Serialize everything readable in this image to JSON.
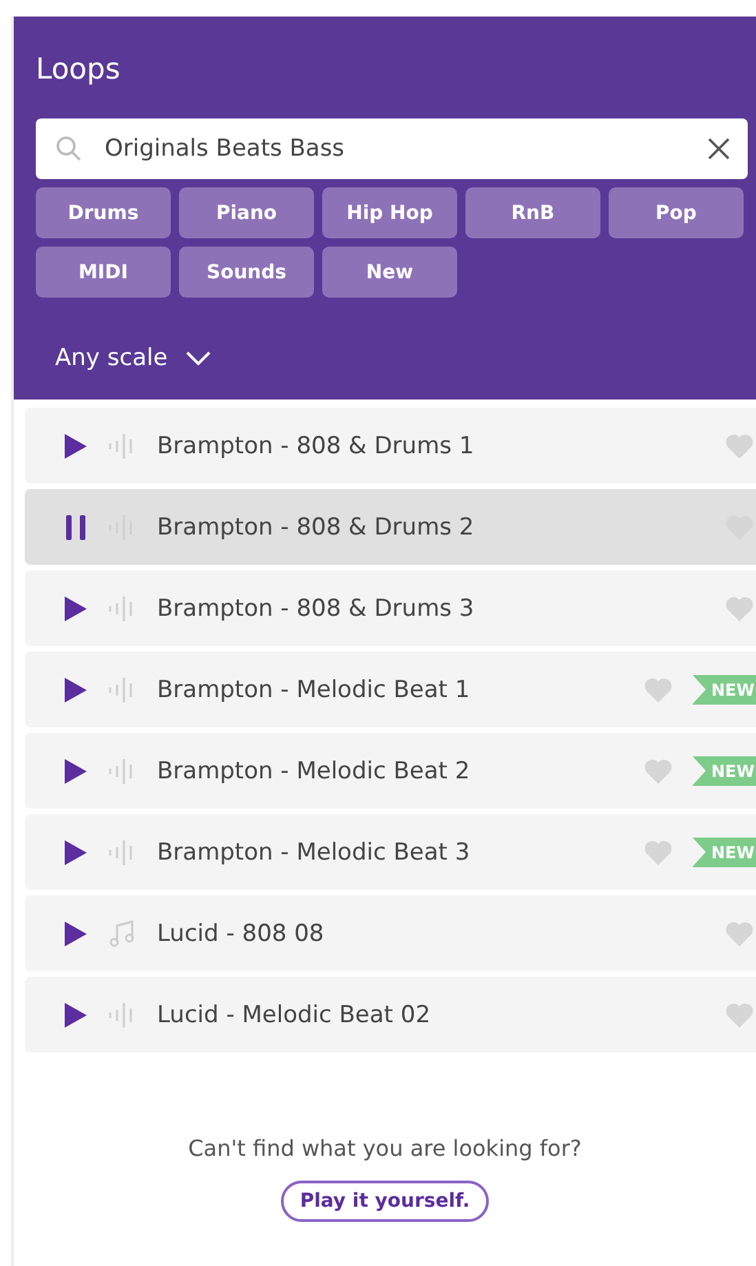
{
  "title": "Loops",
  "search": {
    "value": "Originals Beats Bass"
  },
  "filters": [
    {
      "label": "Drums"
    },
    {
      "label": "Piano"
    },
    {
      "label": "Hip Hop"
    },
    {
      "label": "RnB"
    },
    {
      "label": "Pop"
    },
    {
      "label": "MIDI"
    },
    {
      "label": "Sounds"
    },
    {
      "label": "New"
    }
  ],
  "scale": {
    "label": "Any scale"
  },
  "loops": [
    {
      "name": "Brampton - 808 & Drums 1",
      "playing": false,
      "kind": "audio",
      "new": false
    },
    {
      "name": "Brampton - 808 & Drums 2",
      "playing": true,
      "kind": "audio",
      "new": false
    },
    {
      "name": "Brampton - 808 & Drums 3",
      "playing": false,
      "kind": "audio",
      "new": false
    },
    {
      "name": "Brampton - Melodic Beat 1",
      "playing": false,
      "kind": "audio",
      "new": true,
      "badge": "NEW"
    },
    {
      "name": "Brampton - Melodic Beat 2",
      "playing": false,
      "kind": "audio",
      "new": true,
      "badge": "NEW"
    },
    {
      "name": "Brampton - Melodic Beat 3",
      "playing": false,
      "kind": "audio",
      "new": true,
      "badge": "NEW"
    },
    {
      "name": "Lucid - 808 08",
      "playing": false,
      "kind": "midi",
      "new": false
    },
    {
      "name": "Lucid - Melodic Beat 02",
      "playing": false,
      "kind": "audio",
      "new": false
    }
  ],
  "footer": {
    "text": "Can't find what you are looking for?",
    "button": "Play it yourself."
  }
}
